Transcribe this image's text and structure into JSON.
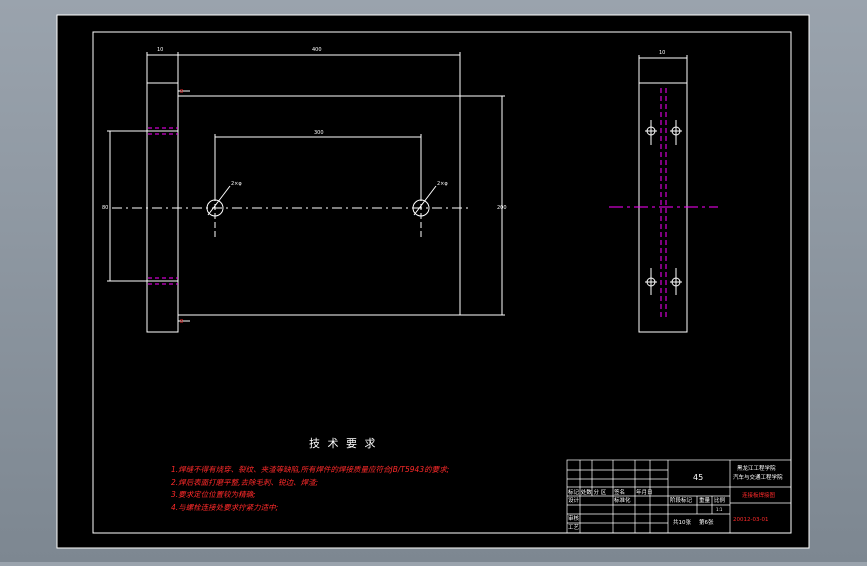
{
  "drawing": {
    "tech_title": "技 术 要 求",
    "requirements": [
      "1.焊缝不得有烧穿、裂纹、夹渣等缺陷,所有焊件的焊接质量应符合JB/T5943的要求;",
      "2.焊后表面打磨平整,去除毛刺、锐边、焊渣;",
      "3.要求定位位置较为精确;",
      "4.与螺栓连接处要求拧紧力适中;"
    ],
    "dims": {
      "d_left_w": "10",
      "d_top": "400",
      "d_inner": "300",
      "d_left_h": "80",
      "d_right_h": "200",
      "d_side_w": "10",
      "hole_label_1": "2×φ",
      "hole_label_2": "2×φ",
      "weld_1": "8",
      "weld_2": "8"
    },
    "title_block": {
      "quantity": "45",
      "school_line1": "黑龙江工程学院",
      "school_line2": "汽车与交通工程学院",
      "part_name": "连接板焊接图",
      "drawing_no": "20012-03-01",
      "row_design": "设计",
      "row_standard": "标准化",
      "row_audit": "审核",
      "row_process": "工艺",
      "col_sign": "签名",
      "col_date": "年月日",
      "h_stage_mark": "阶段标记",
      "h_weight": "重量",
      "h_scale": "比例",
      "scale": "1:1",
      "sheets_total": "共10张",
      "sheet_no": "第6张",
      "marks_header": "标记 处数 分 区"
    }
  },
  "colors": {
    "line": "#ffffff",
    "centerline": "#ff00ff",
    "note": "#ff2a2a",
    "title": "#ffffff",
    "dim": "#ffffff"
  }
}
